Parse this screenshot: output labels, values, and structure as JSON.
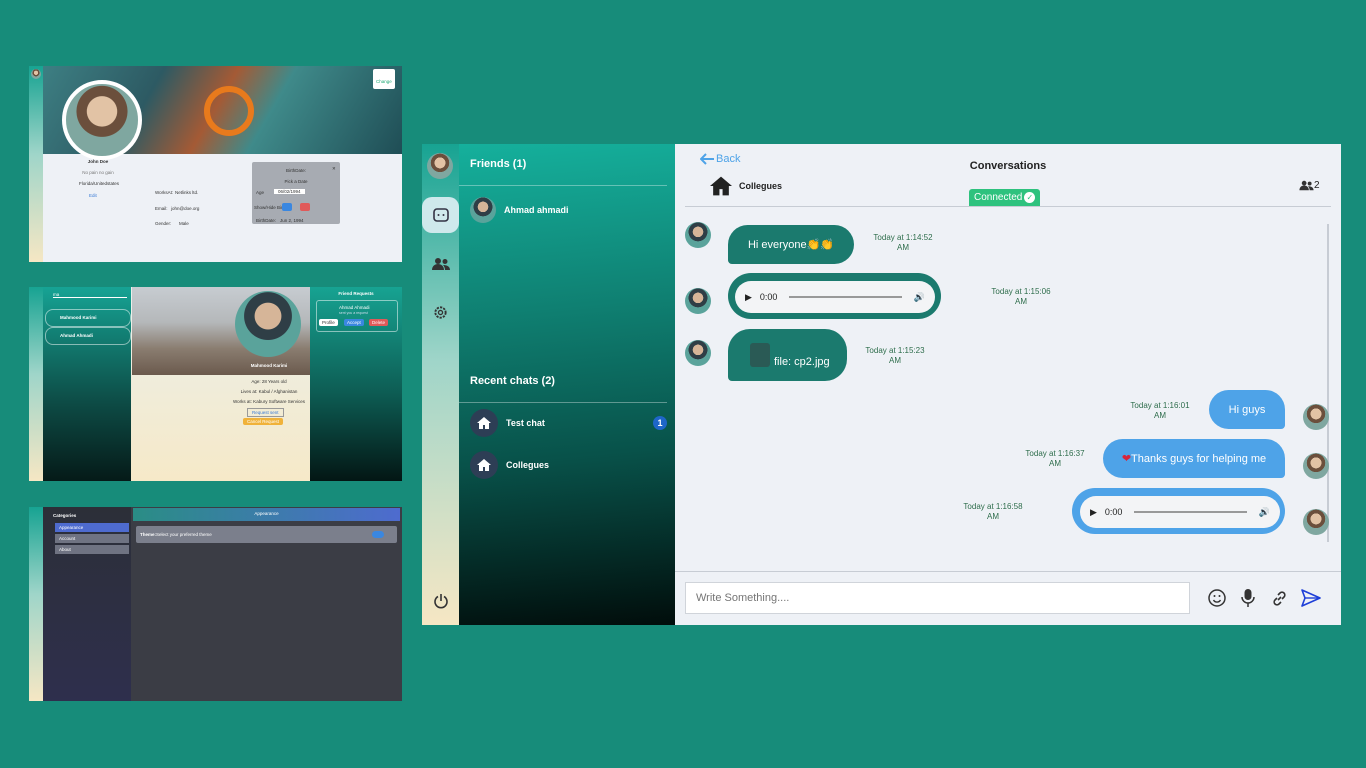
{
  "thumb_profile": {
    "change_label": "Change",
    "name": "John Doe",
    "bio": "No pain no gain",
    "location": "Florida/Unitedstates",
    "edit_label": "Edit",
    "fields": [
      {
        "label": "WorksAt:",
        "value": "Netlinks ltd."
      },
      {
        "label": "Email:",
        "value": "john@doe.org"
      },
      {
        "label": "Gender:",
        "value": "Male"
      }
    ],
    "modal": {
      "title": "BirthDate:",
      "subtitle": "Pick a Date",
      "age_label": "Age",
      "date_value": "06/02/1994",
      "show_label": "Show/Hide Birth",
      "birthdate_label": "BirthDate:",
      "birthdate_value": "Jun 2, 1994"
    }
  },
  "thumb_friends": {
    "search_value": "ma",
    "list": [
      "Mahmood Karimi",
      "Ahmad Ahmadi"
    ],
    "profile_name": "Mahmood Karimi",
    "details": [
      "Age: 28 Years old",
      "Lives at: Kabul / Afghanistan",
      "Works at: Kabury Software Services"
    ],
    "request_sent": "Request sent",
    "cancel_request": "Cancel Request",
    "requests_title": "Friend Requests",
    "request_name": "Ahmad Ahmadi",
    "request_sub": "sent you a request",
    "actions": [
      "Profile",
      "Accept",
      "Delete"
    ]
  },
  "thumb_settings": {
    "categories_title": "Categories",
    "categories": [
      "Appearance",
      "Account",
      "About"
    ],
    "header": "Appearance",
    "theme_label": "Theme:",
    "theme_desc": "Select your preferred theme"
  },
  "friends_panel": {
    "friends_title": "Friends (1)",
    "friends": [
      "Ahmad ahmadi"
    ],
    "recent_title": "Recent chats (2)",
    "recent": [
      {
        "name": "Test chat",
        "badge": "1"
      },
      {
        "name": "Collegues",
        "badge": ""
      }
    ]
  },
  "chat": {
    "back_label": "Back",
    "title": "Conversations",
    "room": "Collegues",
    "status": "Connected",
    "member_count": "2",
    "messages": [
      {
        "text": "Hi everyone👏👏",
        "time1": "Today at 1:14:52",
        "time2": "AM"
      },
      {
        "audio_time": "0:00",
        "time1": "Today at 1:15:06",
        "time2": "AM"
      },
      {
        "text": "file: cp2.jpg",
        "time1": "Today at 1:15:23",
        "time2": "AM"
      },
      {
        "text": "Hi guys",
        "time1": "Today at 1:16:01",
        "time2": "AM"
      },
      {
        "text": "Thanks guys for helping me",
        "time1": "Today at 1:16:37",
        "time2": "AM"
      },
      {
        "audio_time": "0:00",
        "time1": "Today at 1:16:58",
        "time2": "AM"
      }
    ],
    "input_placeholder": "Write Something...."
  },
  "colors": {
    "accent": "#178c7a",
    "bubble_in": "#1b7a6e",
    "bubble_out": "#4ea3e8",
    "connected": "#2ec27e"
  }
}
